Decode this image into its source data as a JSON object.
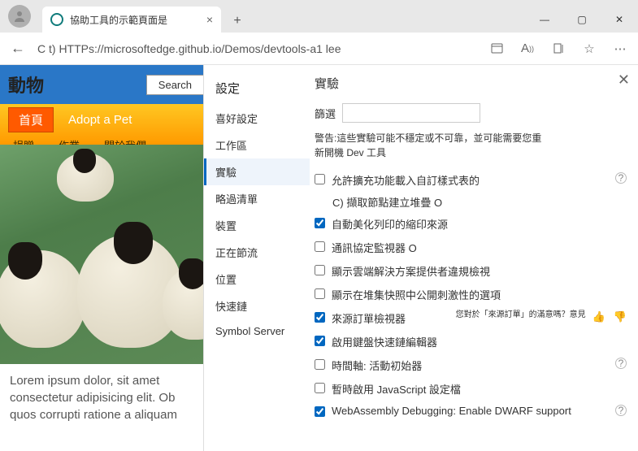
{
  "titlebar": {
    "tab_title": "協助工具的示範頁面是",
    "close_glyph": "×",
    "newtab_glyph": "+",
    "min_glyph": "—",
    "max_glyph": "▢",
    "x_glyph": "✕"
  },
  "addrbar": {
    "back_glyph": "←",
    "url": "C t) HTTPs://microsoftedge.github.io/Demos/devtools-a1 lee",
    "more_glyph": "⋯"
  },
  "page": {
    "logo": "動物",
    "search_label": "Search",
    "home": "首頁",
    "adopt": "Adopt a Pet",
    "nav": {
      "donate": "捐贈",
      "homework": "作業",
      "about": "關於我們"
    },
    "caption": "Lorem ipsum dolor, sit amet consectetur adipisicing elit. Ob quos corrupti ratione a aliquam"
  },
  "devtools": {
    "sidebar_title": "設定",
    "sidebar": {
      "prefs": "喜好設定",
      "workspace": "工作區",
      "experiments": "實驗",
      "ignore": "略過清單",
      "devices": "裝置",
      "throttling": "正在節流",
      "locations": "位置",
      "shortcuts": "快速鏈",
      "symbol": "Symbol Server"
    },
    "panel": {
      "title": "實驗",
      "close_glyph": "✕",
      "filter_label": "篩選",
      "warning": "警告:這些實驗可能不穩定或不可靠，並可能需要您重新開機 Dev 工具",
      "opts": {
        "allow_custom_css": "允許擴充功能載入自訂樣式表的",
        "capture_stack": "C) 擷取節點建立堆疊 O",
        "pretty_print": "自動美化列印的縮印來源",
        "protocol_monitor": "通訊協定監視器 O",
        "show_cloud": "顯示雲端解決方案提供者違規檢視",
        "show_heap": "顯示在堆集快照中公開刺激性的選項",
        "source_order": "來源訂單檢視器",
        "feedback_q": "您對於「來源訂單」的滿意嗎？意見",
        "keyboard_editor": "啟用鍵盤快速鏈編輯器",
        "timeline": "時間軸: 活動初始器",
        "js_profile": "暫時啟用 JavaScript 設定檔",
        "wasm": "WebAssembly Debugging: Enable DWARF support"
      }
    }
  }
}
